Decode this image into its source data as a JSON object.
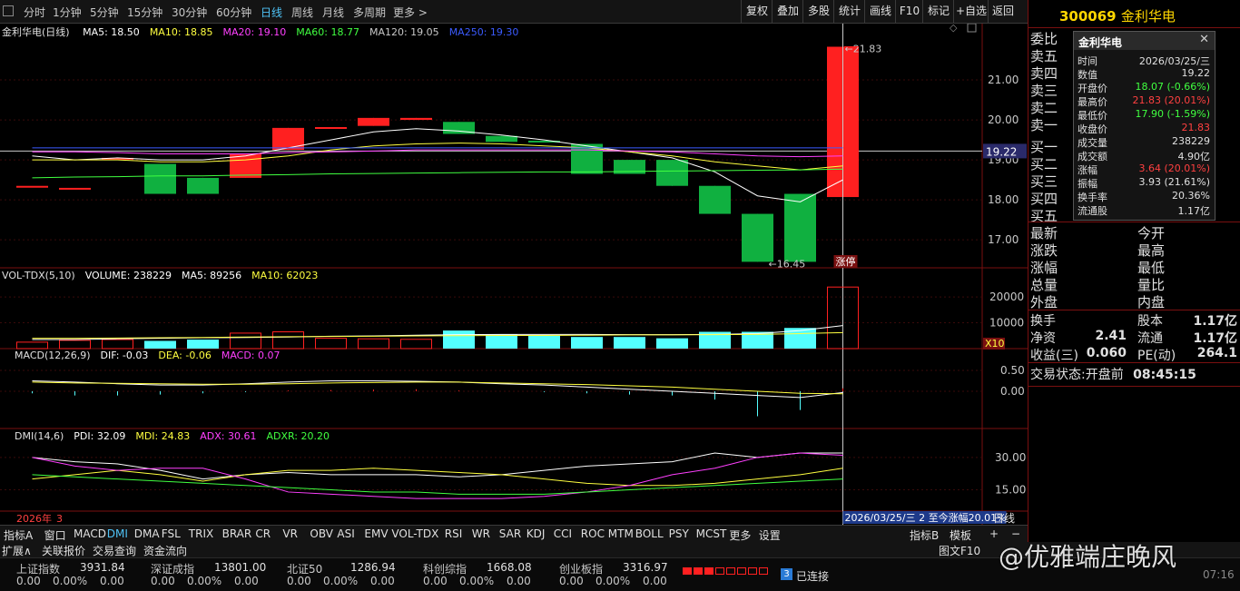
{
  "toolbar": {
    "periods": [
      "分时",
      "1分钟",
      "5分钟",
      "15分钟",
      "30分钟",
      "60分钟",
      "日线",
      "周线",
      "月线",
      "多周期",
      "更多 >"
    ],
    "active_period": "日线",
    "right_buttons": [
      "复权",
      "叠加",
      "多股",
      "统计",
      "画线",
      "F10",
      "标记",
      "+自选",
      "返回"
    ]
  },
  "stock": {
    "code": "300069",
    "name": "金利华电"
  },
  "main_legend": {
    "title": "金利华电(日线)",
    "ma": [
      {
        "text": "MA5: 18.50",
        "color": "#ffffff"
      },
      {
        "text": "MA10: 18.85",
        "color": "#ffff40"
      },
      {
        "text": "MA20: 19.10",
        "color": "#ff40ff"
      },
      {
        "text": "MA60: 18.77",
        "color": "#40ff40"
      },
      {
        "text": "MA120: 19.05",
        "color": "#c8c8c8"
      },
      {
        "text": "MA250: 19.30",
        "color": "#3b5bff"
      }
    ]
  },
  "price_axis": {
    "labels": [
      "21.00",
      "20.00",
      "19.00",
      "18.00",
      "17.00"
    ],
    "current": "19.22"
  },
  "annotations": {
    "high": "←21.83",
    "low": "←16.45",
    "limit_up_tag": "涨停"
  },
  "vol_legend": {
    "title": "VOL-TDX(5,10)",
    "items": [
      {
        "text": "VOLUME: 238229",
        "color": "#ffffff"
      },
      {
        "text": "MA5: 89256",
        "color": "#ffffff"
      },
      {
        "text": "MA10: 62023",
        "color": "#ffff40"
      }
    ]
  },
  "vol_axis": {
    "labels": [
      "20000",
      "10000"
    ],
    "unit": "X10"
  },
  "macd_legend": {
    "title": "MACD(12,26,9)",
    "items": [
      {
        "text": "DIF: -0.03",
        "color": "#ffffff"
      },
      {
        "text": "DEA: -0.06",
        "color": "#ffff40"
      },
      {
        "text": "MACD: 0.07",
        "color": "#ff40ff"
      }
    ]
  },
  "macd_axis": {
    "labels": [
      "0.50",
      "0.00"
    ]
  },
  "dmi_legend": {
    "title": "DMI(14,6)",
    "items": [
      {
        "text": "PDI: 32.09",
        "color": "#ffffff"
      },
      {
        "text": "MDI: 24.83",
        "color": "#ffff40"
      },
      {
        "text": "ADX: 30.61",
        "color": "#ff40ff"
      },
      {
        "text": "ADXR: 20.20",
        "color": "#40ff40"
      }
    ]
  },
  "dmi_axis": {
    "labels": [
      "30.00",
      "15.00"
    ]
  },
  "date_bar": {
    "year": "2026年",
    "month": "3",
    "tip": "2026/03/25/三 2 至今涨幅20.01%",
    "period": "日线"
  },
  "indicator_tabs": [
    "指标A",
    "窗口",
    "MACD",
    "DMI",
    "DMA",
    "FSL",
    "TRIX",
    "BRAR",
    "CR",
    "VR",
    "OBV",
    "ASI",
    "EMV",
    "VOL-TDX",
    "RSI",
    "WR",
    "SAR",
    "KDJ",
    "CCI",
    "ROC",
    "MTM",
    "BOLL",
    "PSY",
    "MCST",
    "更多",
    "设置"
  ],
  "indicator_right": [
    "指标B",
    "模板",
    "+",
    "−"
  ],
  "bottom_tabs": [
    "扩展∧",
    "关联报价",
    "交易查询",
    "资金流向"
  ],
  "bottom_right_label": "图文F10",
  "order_book": [
    "委比",
    "卖五",
    "卖四",
    "卖三",
    "卖二",
    "卖一",
    "买一",
    "买二",
    "买三",
    "买四",
    "买五"
  ],
  "popup": {
    "title": "金利华电",
    "rows": [
      {
        "label": "时间",
        "value": "2026/03/25/三",
        "color": "#e0e0e0"
      },
      {
        "label": "数值",
        "value": "19.22",
        "color": "#e0e0e0"
      },
      {
        "label": "开盘价",
        "value": "18.07 (-0.66%)",
        "color": "#40ff40"
      },
      {
        "label": "最高价",
        "value": "21.83 (20.01%)",
        "color": "#ff4040"
      },
      {
        "label": "最低价",
        "value": "17.90 (-1.59%)",
        "color": "#40ff40"
      },
      {
        "label": "收盘价",
        "value": "21.83",
        "color": "#ff4040"
      },
      {
        "label": "成交量",
        "value": "238229",
        "color": "#e0e0e0"
      },
      {
        "label": "成交额",
        "value": "4.90亿",
        "color": "#e0e0e0"
      },
      {
        "label": "涨幅",
        "value": "3.64 (20.01%)",
        "color": "#ff4040"
      },
      {
        "label": "振幅",
        "value": "3.93 (21.61%)",
        "color": "#e0e0e0"
      },
      {
        "label": "换手率",
        "value": "20.36%",
        "color": "#e0e0e0"
      },
      {
        "label": "流通股",
        "value": "1.17亿",
        "color": "#e0e0e0"
      }
    ]
  },
  "quote_left": [
    "最新",
    "涨跌",
    "涨幅",
    "总量",
    "外盘"
  ],
  "quote_right": [
    "今开",
    "最高",
    "最低",
    "量比",
    "内盘"
  ],
  "fundamentals": [
    {
      "l1": "换手",
      "v1": "",
      "l2": "股本",
      "v2": "1.17亿"
    },
    {
      "l1": "净资",
      "v1": "2.41",
      "l2": "流通",
      "v2": "1.17亿"
    },
    {
      "l1": "收益(三)",
      "v1": "0.060",
      "l2": "PE(动)",
      "v2": "264.1"
    }
  ],
  "trade_status": {
    "label": "交易状态:",
    "status": "开盘前",
    "time": "08:45:15"
  },
  "status_bar": {
    "indices": [
      {
        "name": "上证指数",
        "value": "3931.84",
        "chg": "0.00",
        "pct": "0.00%",
        "amt": "0.00"
      },
      {
        "name": "深证成指",
        "value": "13801.00",
        "chg": "0.00",
        "pct": "0.00%",
        "amt": "0.00"
      },
      {
        "name": "北证50",
        "value": "1286.94",
        "chg": "0.00",
        "pct": "0.00%",
        "amt": "0.00"
      },
      {
        "name": "科创综指",
        "value": "1668.08",
        "chg": "0.00",
        "pct": "0.00%",
        "amt": "0.00"
      },
      {
        "name": "创业板指",
        "value": "3316.97",
        "chg": "0.00",
        "pct": "0.00%",
        "amt": "0.00"
      }
    ],
    "conn_count": "3",
    "conn_text": "已连接",
    "clock": "07:16"
  },
  "watermark": "@优雅端庄晚风",
  "chart_data": {
    "type": "candlestick",
    "candles": [
      {
        "o": 18.35,
        "c": 18.35,
        "h": 18.35,
        "l": 18.35
      },
      {
        "o": 18.3,
        "c": 18.3,
        "h": 18.3,
        "l": 18.3
      },
      {
        "o": 19.05,
        "c": 19.05,
        "h": 19.05,
        "l": 19.05
      },
      {
        "o": 18.9,
        "c": 18.15,
        "h": 18.9,
        "l": 18.15
      },
      {
        "o": 18.55,
        "c": 18.15,
        "h": 18.55,
        "l": 18.15
      },
      {
        "o": 18.55,
        "c": 19.15,
        "h": 19.15,
        "l": 18.55
      },
      {
        "o": 19.25,
        "c": 19.8,
        "h": 19.8,
        "l": 19.25
      },
      {
        "o": 19.8,
        "c": 19.82,
        "h": 19.82,
        "l": 19.8
      },
      {
        "o": 19.85,
        "c": 20.05,
        "h": 20.05,
        "l": 19.85
      },
      {
        "o": 20.0,
        "c": 20.05,
        "h": 20.05,
        "l": 20.0
      },
      {
        "o": 19.95,
        "c": 19.65,
        "h": 19.95,
        "l": 19.65
      },
      {
        "o": 19.6,
        "c": 19.45,
        "h": 19.6,
        "l": 19.45
      },
      {
        "o": 19.48,
        "c": 19.45,
        "h": 19.48,
        "l": 19.45
      },
      {
        "o": 19.4,
        "c": 18.65,
        "h": 19.4,
        "l": 18.65
      },
      {
        "o": 19.0,
        "c": 18.65,
        "h": 19.0,
        "l": 18.65
      },
      {
        "o": 19.0,
        "c": 18.35,
        "h": 19.0,
        "l": 18.35
      },
      {
        "o": 18.35,
        "c": 17.65,
        "h": 18.35,
        "l": 17.65
      },
      {
        "o": 17.65,
        "c": 16.45,
        "h": 17.65,
        "l": 16.45
      },
      {
        "o": 18.15,
        "c": 16.45,
        "h": 18.15,
        "l": 16.45
      },
      {
        "o": 18.07,
        "c": 21.83,
        "h": 21.83,
        "l": 17.9
      }
    ],
    "ma": {
      "MA5": [
        19.1,
        19.0,
        19.05,
        19.0,
        19.0,
        19.1,
        19.3,
        19.5,
        19.7,
        19.78,
        19.72,
        19.62,
        19.5,
        19.35,
        19.2,
        19.05,
        18.7,
        18.1,
        17.95,
        18.5
      ],
      "MA10": [
        19.0,
        19.0,
        19.0,
        18.95,
        18.95,
        19.0,
        19.1,
        19.25,
        19.35,
        19.4,
        19.42,
        19.4,
        19.35,
        19.3,
        19.2,
        19.1,
        18.95,
        18.85,
        18.75,
        18.85
      ],
      "MA20": [
        19.2,
        19.2,
        19.18,
        19.15,
        19.15,
        19.15,
        19.18,
        19.2,
        19.22,
        19.25,
        19.25,
        19.25,
        19.25,
        19.25,
        19.22,
        19.2,
        19.15,
        19.1,
        19.08,
        19.1
      ],
      "MA60": [
        18.55,
        18.57,
        18.58,
        18.6,
        18.6,
        18.62,
        18.63,
        18.65,
        18.66,
        18.67,
        18.68,
        18.69,
        18.7,
        18.7,
        18.71,
        18.72,
        18.73,
        18.74,
        18.75,
        18.77
      ],
      "MA250": [
        19.3,
        19.3,
        19.3,
        19.3,
        19.3,
        19.3,
        19.3,
        19.3,
        19.3,
        19.3,
        19.3,
        19.3,
        19.3,
        19.3,
        19.3,
        19.3,
        19.3,
        19.3,
        19.3,
        19.3
      ]
    },
    "volume": [
      2500,
      3200,
      3500,
      3000,
      3500,
      6000,
      6500,
      4000,
      3800,
      3600,
      7000,
      5500,
      5000,
      4500,
      4500,
      4000,
      6500,
      6500,
      8000,
      23822
    ],
    "vol_ma5": [
      3500,
      3500,
      3800,
      4000,
      4200,
      4300,
      4500,
      4800,
      4900,
      5200,
      5400,
      5500,
      5500,
      5500,
      5400,
      5400,
      5500,
      5800,
      7000,
      8926
    ],
    "vol_ma10": [
      4000,
      4000,
      4100,
      4200,
      4300,
      4500,
      4600,
      4700,
      4800,
      4900,
      5000,
      5100,
      5100,
      5200,
      5300,
      5300,
      5400,
      5500,
      5800,
      6202
    ],
    "macd_bar": [
      -0.05,
      -0.1,
      -0.1,
      -0.08,
      -0.05,
      -0.02,
      0.02,
      0.03,
      0.04,
      0.05,
      0.02,
      0.0,
      -0.02,
      -0.05,
      -0.08,
      -0.1,
      -0.2,
      -0.6,
      -0.45,
      0.07
    ],
    "dif": [
      0.25,
      0.22,
      0.18,
      0.15,
      0.15,
      0.18,
      0.22,
      0.25,
      0.25,
      0.24,
      0.22,
      0.18,
      0.15,
      0.1,
      0.05,
      0.0,
      -0.05,
      -0.1,
      -0.15,
      -0.03
    ],
    "dea": [
      0.22,
      0.2,
      0.19,
      0.18,
      0.17,
      0.17,
      0.18,
      0.2,
      0.21,
      0.22,
      0.22,
      0.2,
      0.18,
      0.16,
      0.13,
      0.1,
      0.05,
      0.0,
      -0.05,
      -0.06
    ],
    "pdi": [
      30,
      28,
      27,
      24,
      20,
      22,
      23,
      22,
      22,
      22,
      21,
      22,
      24,
      26,
      27,
      28,
      32,
      30,
      32,
      32
    ],
    "mdi": [
      20,
      22,
      24,
      22,
      19,
      22,
      24,
      24,
      25,
      24,
      23,
      22,
      20,
      18,
      17,
      17,
      18,
      20,
      22,
      25
    ],
    "adx": [
      30,
      26,
      24,
      25,
      25,
      20,
      14,
      13,
      12,
      11,
      11,
      11,
      12,
      14,
      17,
      22,
      25,
      30,
      32,
      31
    ],
    "adxr": [
      22,
      21,
      20,
      19,
      18,
      17,
      16,
      15,
      14,
      14,
      13,
      13,
      13,
      14,
      15,
      16,
      17,
      18,
      19,
      20
    ],
    "price_range": [
      16.3,
      22.0
    ],
    "volume_range": [
      0,
      26000
    ],
    "macd_range": [
      -0.85,
      0.85
    ],
    "dmi_range": [
      6,
      40
    ]
  }
}
